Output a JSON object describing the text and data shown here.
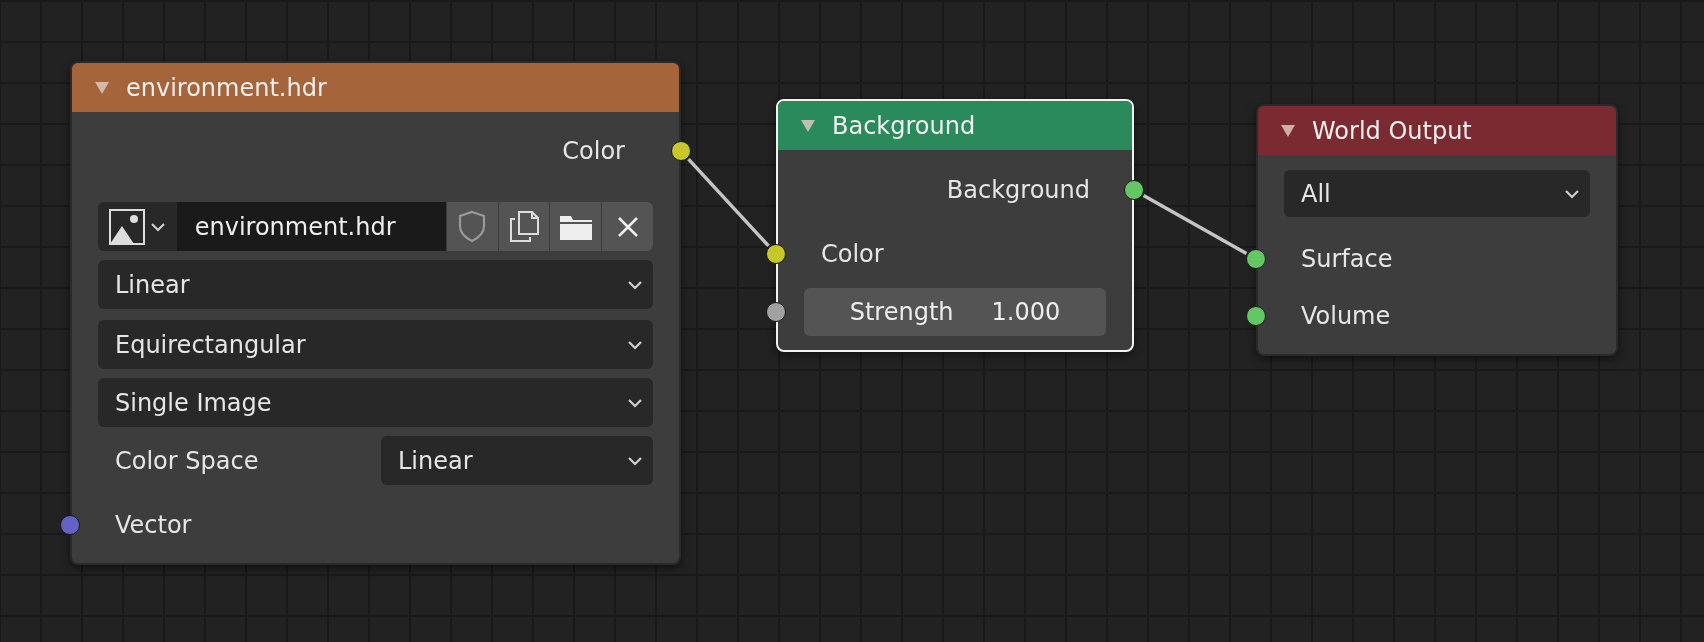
{
  "nodes": [
    {
      "title": "environment.hdr",
      "color": "#a5643a",
      "selected": false,
      "rows": [
        {
          "kind": "output",
          "label": "Color",
          "color": "#c7c729"
        },
        {
          "kind": "image",
          "value": "environment.hdr"
        },
        {
          "kind": "dropdown",
          "value": "Linear"
        },
        {
          "kind": "dropdown",
          "value": "Equirectangular"
        },
        {
          "kind": "dropdown",
          "value": "Single Image"
        },
        {
          "kind": "labeled_dropdown",
          "label": "Color Space",
          "value": "Linear"
        },
        {
          "kind": "input",
          "label": "Vector",
          "color": "#6363c7"
        }
      ]
    },
    {
      "title": "Background",
      "color": "#2b8a5c",
      "selected": true,
      "rows": [
        {
          "kind": "output",
          "label": "Background",
          "color": "#63c763"
        },
        {
          "kind": "input",
          "label": "Color",
          "color": "#c7c729"
        },
        {
          "kind": "value_input",
          "label": "Strength",
          "value": "1.000",
          "color": "#a1a1a1"
        }
      ]
    },
    {
      "title": "World Output",
      "color": "#7c2a31",
      "selected": false,
      "rows": [
        {
          "kind": "dropdown",
          "value": "All"
        },
        {
          "kind": "input",
          "label": "Surface",
          "color": "#63c763"
        },
        {
          "kind": "input",
          "label": "Volume",
          "color": "#63c763"
        }
      ]
    }
  ]
}
